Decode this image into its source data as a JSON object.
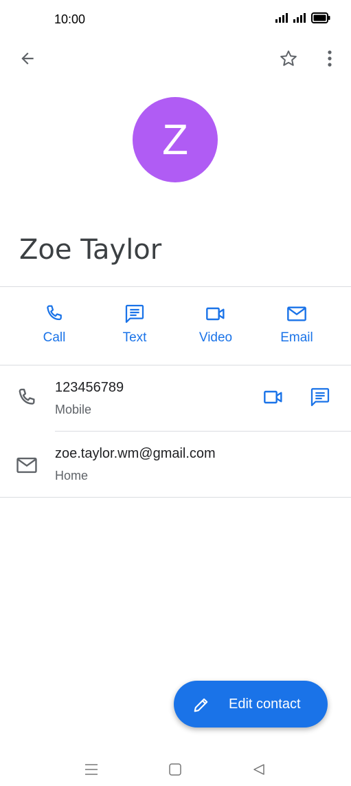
{
  "status_bar": {
    "time": "10:00"
  },
  "contact": {
    "initial": "Z",
    "name": "Zoe Taylor",
    "avatar_color": "#b05cf4"
  },
  "actions": [
    {
      "label": "Call",
      "icon": "phone-icon"
    },
    {
      "label": "Text",
      "icon": "message-icon"
    },
    {
      "label": "Video",
      "icon": "video-icon"
    },
    {
      "label": "Email",
      "icon": "email-icon"
    }
  ],
  "phone": {
    "number": "123456789",
    "type": "Mobile"
  },
  "email": {
    "address": "zoe.taylor.wm@gmail.com",
    "type": "Home"
  },
  "fab": {
    "label": "Edit contact",
    "icon": "pencil-icon"
  },
  "colors": {
    "accent": "#1a73e8",
    "text": "#202124",
    "secondary": "#5f6368",
    "divider": "#dadce0"
  }
}
